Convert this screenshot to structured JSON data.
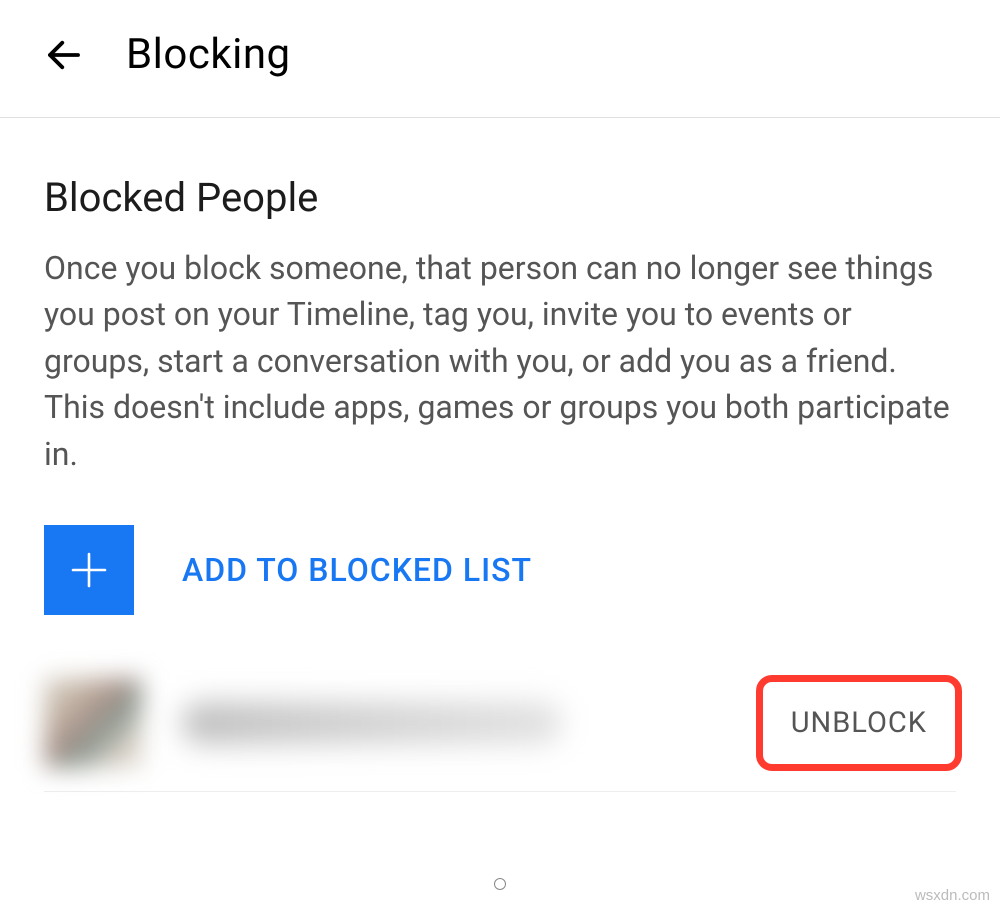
{
  "header": {
    "title": "Blocking"
  },
  "section": {
    "title": "Blocked People",
    "description": "Once you block someone, that person can no longer see things you post on your Timeline, tag you, invite you to events or groups, start a conversation with you, or add you as a friend. This doesn't include apps, games or groups you both participate in."
  },
  "actions": {
    "add_label": "ADD TO BLOCKED LIST",
    "unblock_label": "UNBLOCK"
  },
  "watermark": "wsxdn.com"
}
